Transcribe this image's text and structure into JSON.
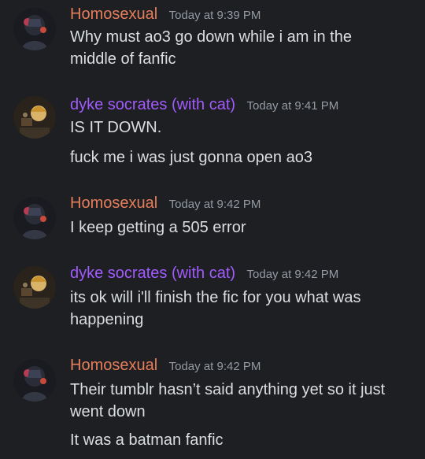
{
  "users": {
    "homosexual": {
      "name": "Homosexual",
      "color": "#e67e5b"
    },
    "dyke": {
      "name": "dyke socrates (with cat)",
      "color": "#a25bff"
    }
  },
  "messages": [
    {
      "author": "Homosexual",
      "time": "Today at 9:39 PM",
      "lines": [
        "Why must ao3 go down while i am in the",
        "middle of fanfic"
      ]
    },
    {
      "author": "dyke socrates (with cat)",
      "time": "Today at 9:41 PM",
      "lines": [
        "IS IT DOWN.",
        "fuck me i was just gonna open ao3"
      ]
    },
    {
      "author": "Homosexual",
      "time": "Today at 9:42 PM",
      "lines": [
        "I keep getting a 505 error"
      ]
    },
    {
      "author": "dyke socrates (with cat)",
      "time": "Today at 9:42 PM",
      "lines": [
        "its ok will i'll finish the fic for you what was",
        "happening"
      ]
    },
    {
      "author": "Homosexual",
      "time": "Today at 9:42 PM",
      "lines": [
        "Their tumblr hasn’t said anything yet so it just",
        "went down",
        "It was a batman fanfic"
      ]
    }
  ]
}
